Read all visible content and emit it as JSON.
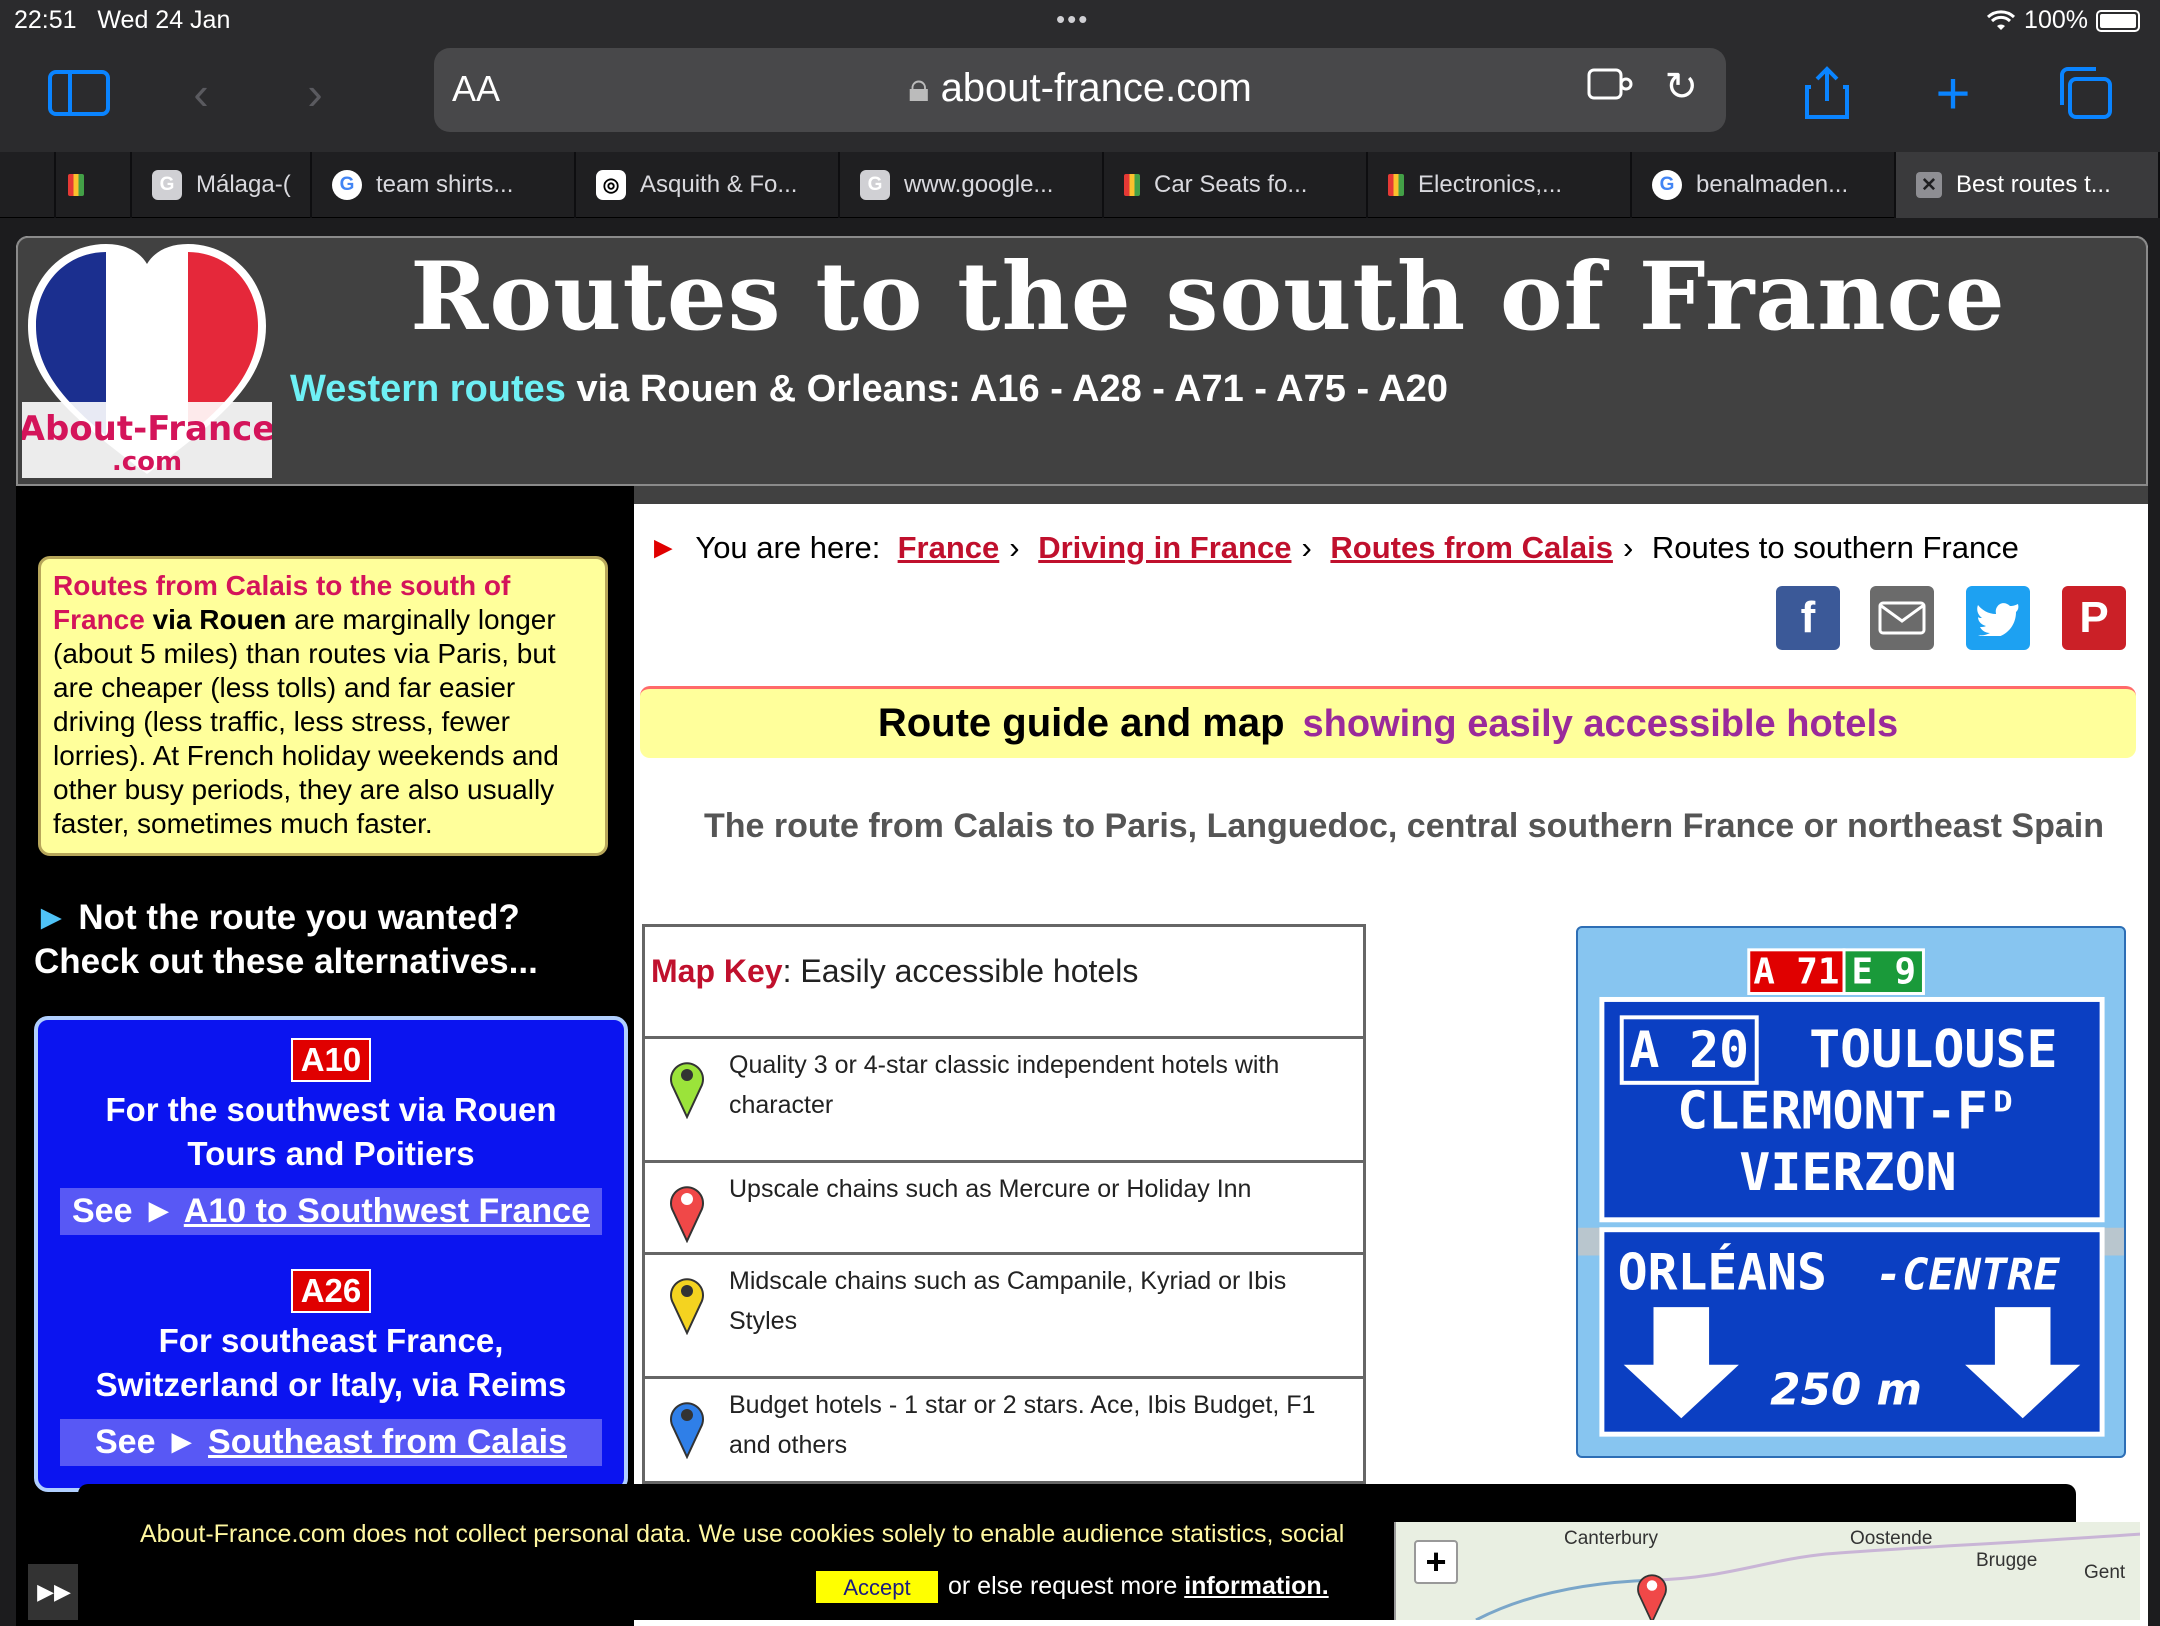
{
  "status": {
    "time": "22:51",
    "date": "Wed 24 Jan",
    "battery": "100%"
  },
  "browser": {
    "text_size_label": "AA",
    "url": "about-france.com",
    "tabs": [
      {
        "label": ""
      },
      {
        "label": ""
      },
      {
        "label": "Málaga-("
      },
      {
        "label": "team shirts..."
      },
      {
        "label": "Asquith & Fo..."
      },
      {
        "label": "www.google..."
      },
      {
        "label": "Car Seats fo..."
      },
      {
        "label": "Electronics,..."
      },
      {
        "label": "benalmaden..."
      },
      {
        "label": "Best routes t..."
      }
    ]
  },
  "header": {
    "logo_text": "About-France",
    "logo_sub": ".com",
    "title": "Routes to the south of France",
    "subtitle_highlight": "Western routes",
    "subtitle_rest": " via Rouen & Orleans: A16 - A28 - A71 - A75 - A20"
  },
  "sidebar": {
    "intro_pink": "Routes from Calais to the south of France",
    "intro_bold": " via Rouen",
    "intro_rest": " are marginally longer (about 5 miles) than routes via Paris, but are cheaper (less tolls) and far easier driving (less traffic, less stress, fewer lorries). At French holiday weekends and other busy periods, they are also usually faster, sometimes much faster.",
    "not_route": "Not the route you wanted?",
    "check_out": "Check out these alternatives...",
    "alt1": {
      "badge": "A10",
      "desc1": "For the southwest via Rouen",
      "desc2": "Tours and Poitiers",
      "see": "See ►",
      "link": "A10 to Southwest France"
    },
    "alt2": {
      "badge": "A26",
      "desc1": "For southeast France,",
      "desc2": "Switzerland or Italy, via Reims",
      "see": "See ►",
      "link": "Southeast from Calais"
    }
  },
  "breadcrumb": {
    "prefix": "You are here:",
    "items": [
      "France",
      "Driving in France",
      "Routes from Calais"
    ],
    "current": "Routes to southern France"
  },
  "guide": {
    "title": "Route guide and map",
    "subtitle": "showing easily accessible hotels"
  },
  "route_heading": "The route from Calais to Paris, Languedoc, central southern France or northeast Spain",
  "map_key": {
    "label": "Map Key",
    "title": ": Easily accessible hotels",
    "rows": [
      {
        "text": "Quality 3 or 4-star classic independent hotels with character",
        "color": "#9be33a"
      },
      {
        "text": "Upscale chains such as Mercure or Holiday Inn",
        "color": "#f04848"
      },
      {
        "text": "Midscale chains such as Campanile, Kyriad or Ibis Styles",
        "color": "#f4d320"
      },
      {
        "text": "Budget hotels - 1 star or 2 stars. Ace, Ibis Budget, F1 and others",
        "color": "#2f7fe8"
      }
    ]
  },
  "road_sign": {
    "top_badge": "A 71",
    "top_euro": "E 9",
    "road": "A 20",
    "line1": "TOULOUSE",
    "line2": "CLERMONT-Fᴰ",
    "line3": "VIERZON",
    "line4": "ORLÉANS",
    "line4b": "-CENTRE",
    "distance": "250 m"
  },
  "cookie": {
    "message": "About-France.com does not collect personal data. We use cookies solely to enable audience statistics, social",
    "accept": "Accept",
    "or_text": "or else request more ",
    "info": "information."
  },
  "mini_map": {
    "zoom_in": "+",
    "labels": [
      "Canterbury",
      "Oostende",
      "Brugge",
      "Gent"
    ]
  },
  "colors": {
    "header_bg": "#414141",
    "accent_pink": "#d4145a",
    "sidebar_blue": "#0b14f0",
    "highlight_yellow": "#ffff9b"
  }
}
